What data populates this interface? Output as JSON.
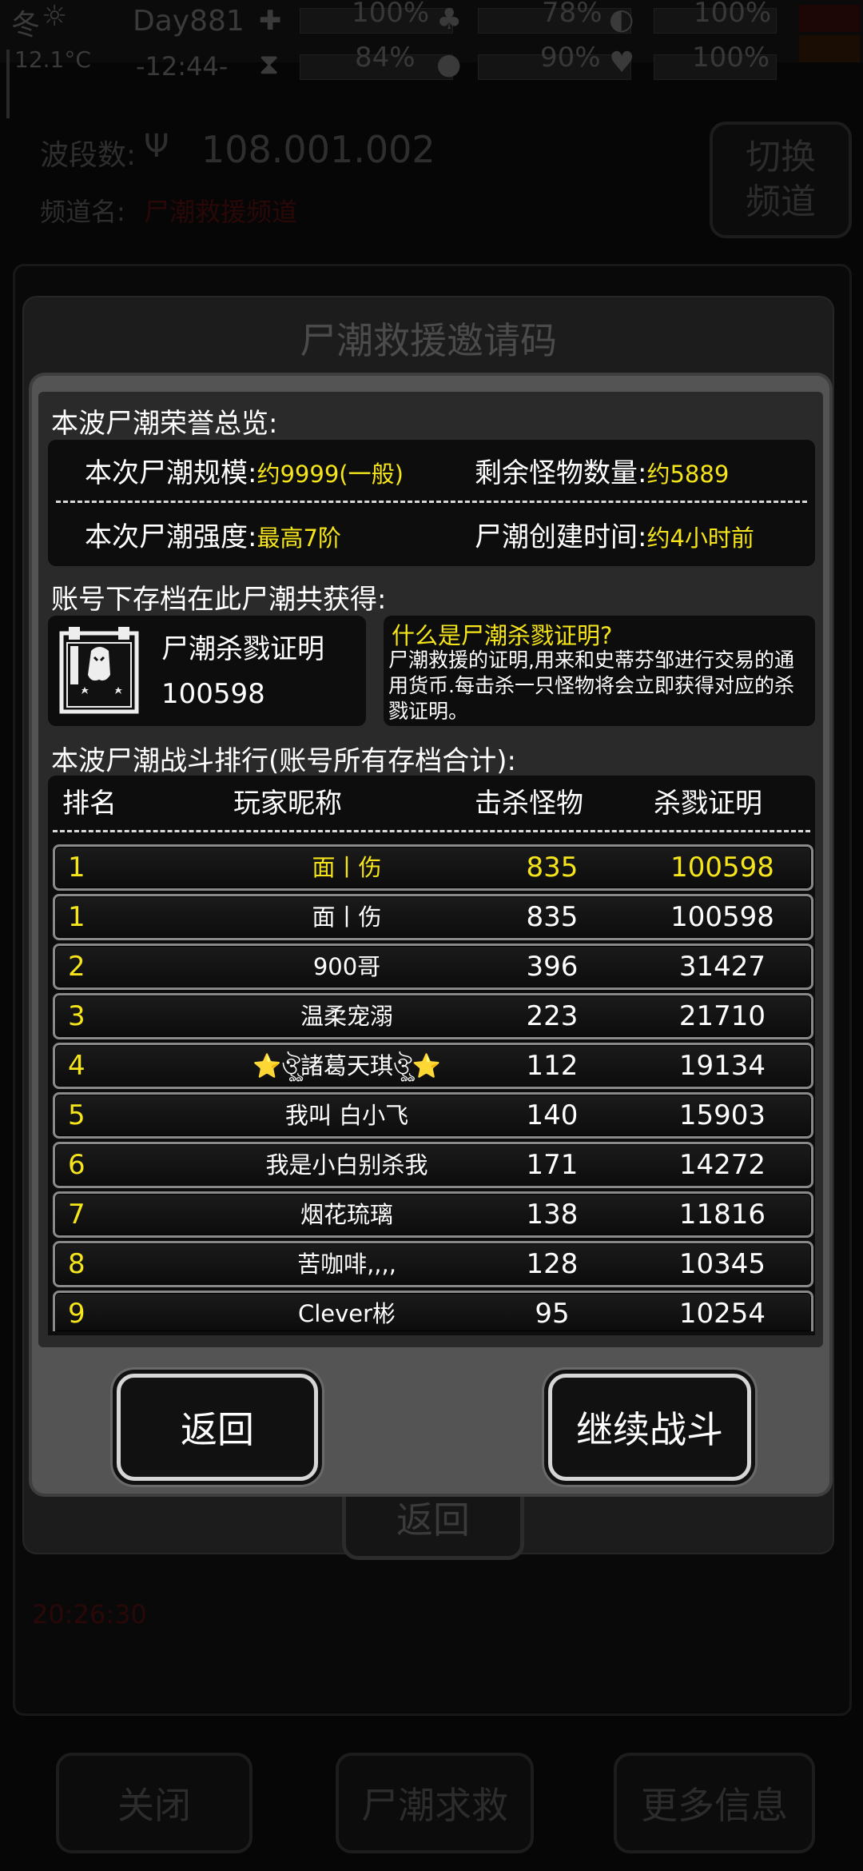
{
  "status": {
    "season": "冬",
    "day": "Day881",
    "temperature": "12.1°C",
    "time": "-12:44-",
    "stats": [
      {
        "icon": "medkit-icon",
        "value": "100%"
      },
      {
        "icon": "tree-icon",
        "value": "78%"
      },
      {
        "icon": "stomach-icon",
        "value": "100%"
      },
      {
        "icon": "hourglass-icon",
        "value": "84%"
      },
      {
        "icon": "water-drop-icon",
        "value": "90%"
      },
      {
        "icon": "heart-icon",
        "value": "100%"
      }
    ]
  },
  "radio": {
    "band_label": "波段数:",
    "frequency": "108.001.002",
    "channel_label": "频道名:",
    "channel_name": "尸潮救援频道",
    "switch_button": "切换频道"
  },
  "background": {
    "mid_dialog_title": "尸潮救援邀请码",
    "mid_back_button": "返回",
    "log_time": "20:26:30",
    "bottom_buttons": [
      "关闭",
      "尸潮求救",
      "更多信息"
    ]
  },
  "overview": {
    "heading": "本波尸潮荣誉总览:",
    "scale_label": "本次尸潮规模:",
    "scale_value": "约9999(一般)",
    "remaining_label": "剩余怪物数量:",
    "remaining_value": "约5889",
    "strength_label": "本次尸潮强度:",
    "strength_value": "最高7阶",
    "created_label": "尸潮创建时间:",
    "created_value": "约4小时前"
  },
  "earned": {
    "heading": "账号下存档在此尸潮共获得:",
    "cert_name": "尸潮杀戮证明",
    "cert_amount": "100598",
    "info_title": "什么是尸潮杀戮证明?",
    "info_text": "尸潮救援的证明,用来和史蒂芬邹进行交易的通用货币.每击杀一只怪物将会立即获得对应的杀戮证明。"
  },
  "ranking": {
    "heading": "本波尸潮战斗排行(账号所有存档合计):",
    "columns": [
      "排名",
      "玩家昵称",
      "击杀怪物",
      "杀戮证明"
    ],
    "rows": [
      {
        "rank": "1",
        "name": "面丨伤",
        "kills": "835",
        "certs": "100598"
      },
      {
        "rank": "1",
        "name": "面丨伤",
        "kills": "835",
        "certs": "100598"
      },
      {
        "rank": "2",
        "name": "900哥",
        "kills": "396",
        "certs": "31427"
      },
      {
        "rank": "3",
        "name": "温柔宠溺",
        "kills": "223",
        "certs": "21710"
      },
      {
        "rank": "4",
        "name": "⭐ঔৣ諸葛天琪ঔৣ⭐",
        "kills": "112",
        "certs": "19134"
      },
      {
        "rank": "5",
        "name": "我叫 白小飞",
        "kills": "140",
        "certs": "15903"
      },
      {
        "rank": "6",
        "name": "我是小白别杀我",
        "kills": "171",
        "certs": "14272"
      },
      {
        "rank": "7",
        "name": "烟花琉璃",
        "kills": "138",
        "certs": "11816"
      },
      {
        "rank": "8",
        "name": "苦咖啡,,,,",
        "kills": "128",
        "certs": "10345"
      },
      {
        "rank": "9",
        "name": "Clever彬",
        "kills": "95",
        "certs": "10254"
      }
    ]
  },
  "buttons": {
    "back": "返回",
    "continue": "继续战斗"
  },
  "colors": {
    "highlight": "#f5e51a",
    "dialog_frame": "#545454",
    "card_bg": "#0d0d0d"
  }
}
